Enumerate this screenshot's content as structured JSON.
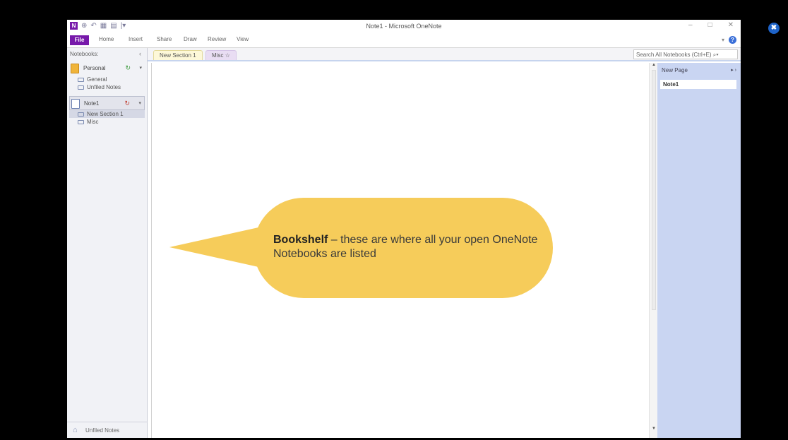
{
  "window": {
    "title": "Note1 - Microsoft OneNote",
    "controls": [
      "–",
      "□",
      "✕"
    ]
  },
  "quick_access": {
    "logo": "N",
    "icons": [
      "⊕",
      "↶",
      "▦",
      "▤",
      "|▾"
    ]
  },
  "ribbon": {
    "tabs": [
      "File",
      "Home",
      "Insert",
      "Share",
      "Draw",
      "Review",
      "View"
    ],
    "collapse": "▾",
    "help": "?"
  },
  "sidebar": {
    "header": "Notebooks:",
    "collapse_icon": "‹",
    "notebooks": [
      {
        "name": "Personal",
        "color": "#f0b43a",
        "sync": "↻",
        "sections": [
          "General",
          "Unfiled Notes"
        ]
      },
      {
        "name": "Note1",
        "color": "#ffffff",
        "sync": "↻",
        "sections": [
          "New Section 1",
          "Misc"
        ]
      }
    ],
    "footer": "Unfiled Notes"
  },
  "section_tabs": {
    "tabs": [
      "New Section 1",
      "Misc"
    ],
    "add": "☆",
    "search_placeholder": "Search All Notebooks (Ctrl+E)"
  },
  "pages_pane": {
    "new_page": "New Page",
    "nav": "▸ ›",
    "pages": [
      "Note1"
    ]
  },
  "callout": {
    "bold": "Bookshelf",
    "text": " – these are where all your open OneNote Notebooks are listed",
    "color": "#f6cc5a"
  },
  "overlay": {
    "close_icon": "✖"
  }
}
